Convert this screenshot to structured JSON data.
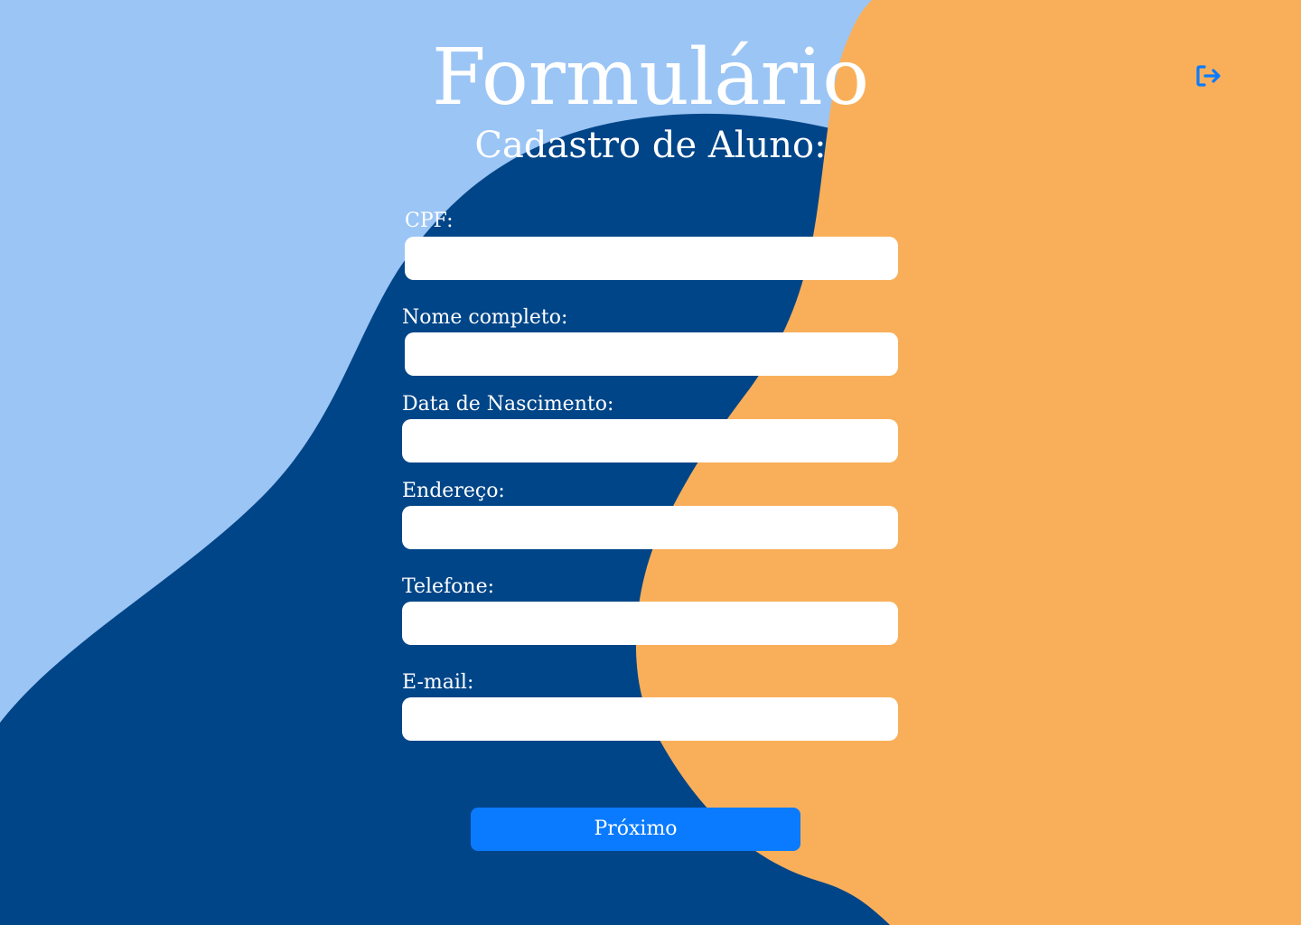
{
  "header": {
    "title": "Formulário",
    "subtitle": "Cadastro de Aluno:"
  },
  "form": {
    "cpf": {
      "label": "CPF:",
      "value": ""
    },
    "nome": {
      "label": "Nome completo:",
      "value": ""
    },
    "nascimento": {
      "label": "Data de Nascimento:",
      "value": ""
    },
    "endereco": {
      "label": "Endereço:",
      "value": ""
    },
    "telefone": {
      "label": "Telefone:",
      "value": ""
    },
    "email": {
      "label": "E-mail:",
      "value": ""
    }
  },
  "actions": {
    "next_label": "Próximo",
    "logout_icon": "logout-icon"
  },
  "colors": {
    "light_blue": "#9BC5F5",
    "dark_blue": "#004588",
    "orange": "#F9AF5A",
    "accent_blue": "#0A7BFF",
    "white": "#FFFFFF"
  }
}
